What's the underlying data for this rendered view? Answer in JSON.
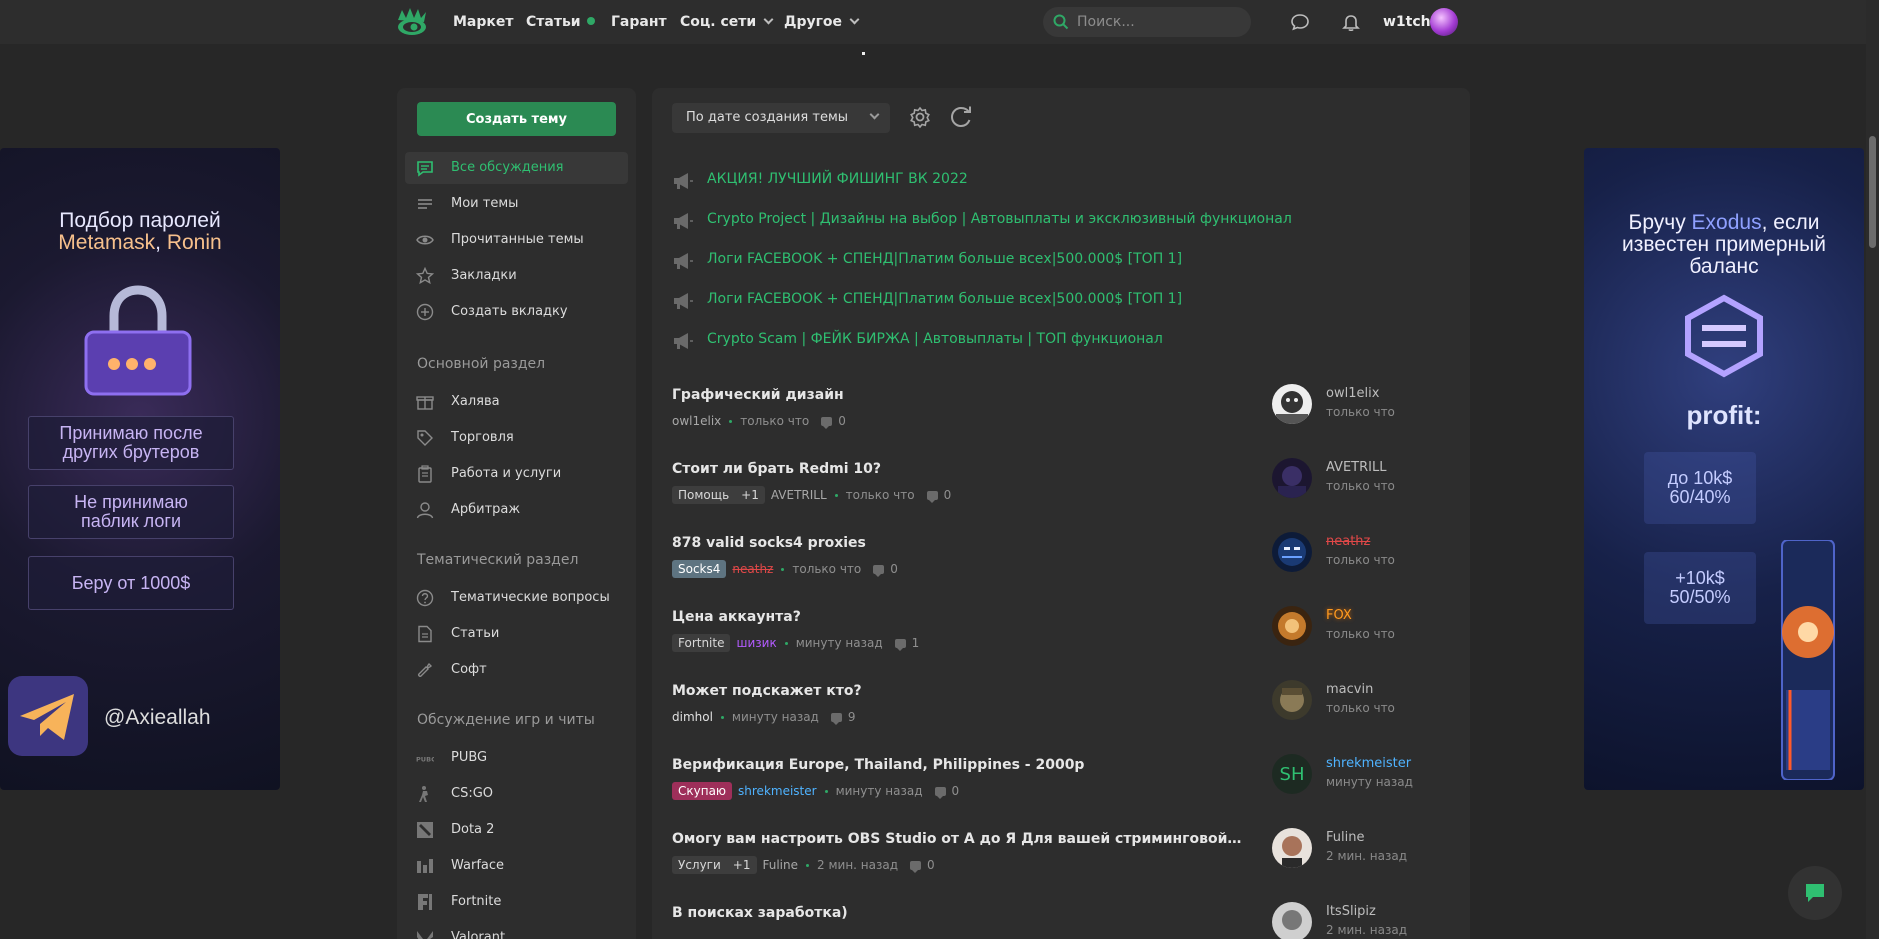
{
  "topbar": {
    "logo_icon": "eye-logo-icon",
    "nav": [
      {
        "label": "Маркет"
      },
      {
        "label": "Статьи",
        "has_dot": true
      },
      {
        "label": "Гарант"
      },
      {
        "label": "Соц. сети",
        "has_chevron": true
      },
      {
        "label": "Другое",
        "has_chevron": true
      }
    ],
    "search_placeholder": "Поиск...",
    "username": "w1tch"
  },
  "banner_left": {
    "title_line1": "Подбор паролей",
    "title_line2a": "Metamask",
    "title_line2b": ", ",
    "title_line2c": "Ronin",
    "box1_line1": "Принимаю после",
    "box1_line2": "других брутеров",
    "box2_line1": "Не принимаю",
    "box2_line2": "паблик логи",
    "box3": "Беру от 1000$",
    "handle": "@Axieallah"
  },
  "banner_right": {
    "title_line1a": "Бручу ",
    "title_line1b": "Exodus",
    "title_line1c": ", если",
    "title_line2": "известен примерный",
    "title_line3": "баланс",
    "profit": "profit:",
    "box1_line1": "до 10k$",
    "box1_line2": "60/40%",
    "box2_line1": "+10k$",
    "box2_line2": "50/50%"
  },
  "sidebar": {
    "create_button": "Создать тему",
    "items": [
      {
        "label": "Все обсуждения",
        "icon": "chat-bubble-icon",
        "active": true
      },
      {
        "label": "Мои темы",
        "icon": "lines-icon"
      },
      {
        "label": "Прочитанные темы",
        "icon": "eye-icon"
      },
      {
        "label": "Закладки",
        "icon": "star-icon"
      },
      {
        "label": "Создать вкладку",
        "icon": "plus-circle-icon"
      }
    ],
    "sections": [
      {
        "title": "Основной раздел",
        "items": [
          {
            "label": "Халява",
            "icon": "gift-icon"
          },
          {
            "label": "Торговля",
            "icon": "tag-icon"
          },
          {
            "label": "Работа и услуги",
            "icon": "clipboard-icon"
          },
          {
            "label": "Арбитраж",
            "icon": "user-icon"
          }
        ]
      },
      {
        "title": "Тематический раздел",
        "items": [
          {
            "label": "Тематические вопросы",
            "icon": "question-icon"
          },
          {
            "label": "Статьи",
            "icon": "document-icon"
          },
          {
            "label": "Софт",
            "icon": "wrench-icon"
          }
        ]
      },
      {
        "title": "Обсуждение игр и читы",
        "items": [
          {
            "label": "PUBG",
            "icon": "pubg-icon"
          },
          {
            "label": "CS:GO",
            "icon": "csgo-icon"
          },
          {
            "label": "Dota 2",
            "icon": "dota-icon"
          },
          {
            "label": "Warface",
            "icon": "warface-icon"
          },
          {
            "label": "Fortnite",
            "icon": "fortnite-icon"
          },
          {
            "label": "Valorant",
            "icon": "valorant-icon"
          }
        ]
      }
    ]
  },
  "main": {
    "sort_label": "По дате создания темы",
    "sticky": [
      "АКЦИЯ! ЛУЧШИЙ ФИШИНГ ВК 2022",
      "Crypto Project | Дизайны на выбор | Автовыплаты и эксклюзивный функционал",
      "Логи FACEBOOK + СПЕНД|Платим больше всех|500.000$ [ТОП 1]",
      "Логи FACEBOOK + СПЕНД|Платим больше всех|500.000$ [ТОП 1]",
      "Crypto Scam | ФЕЙК БИРЖА | Автовыплаты | ТОП функционал"
    ],
    "threads": [
      {
        "title": "Графический дизайн",
        "prefix": "",
        "plus": "",
        "author": "owl1elix",
        "time": "только что",
        "comments": "0",
        "last_user": "owl1elix",
        "last_time": "только что"
      },
      {
        "title": "Стоит ли брать Redmi 10?",
        "prefix": "Помощь",
        "plus": "+1",
        "author": "AVETRILL",
        "time": "только что",
        "comments": "0",
        "last_user": "AVETRILL",
        "last_time": "только что"
      },
      {
        "title": "878 valid socks4 proxies",
        "prefix": "Socks4",
        "plus": "",
        "author": "neathz",
        "time": "только что",
        "comments": "0",
        "last_user": "neathz",
        "last_time": "только что"
      },
      {
        "title": "Цена аккаунта?",
        "prefix": "Fortnite",
        "plus": "",
        "author": "шизик",
        "time": "минуту назад",
        "comments": "1",
        "last_user": "FOX",
        "last_time": "только что"
      },
      {
        "title": "Может подскажет кто?",
        "prefix": "",
        "plus": "",
        "author": "dimhol",
        "time": "минуту назад",
        "comments": "9",
        "last_user": "macvin",
        "last_time": "только что"
      },
      {
        "title": "Верификация Europe, Thailand, Philippines - 2000р",
        "prefix": "Скупаю",
        "plus": "",
        "author": "shrekmeister",
        "time": "минуту назад",
        "comments": "0",
        "last_user": "shrekmeister",
        "last_time": "минуту назад",
        "last_initials": "SH"
      },
      {
        "title": "Омогу вам настроить OBS Studio от А до Я Для вашей стриминговой деятельности",
        "prefix": "Услуги",
        "plus": "+1",
        "author": "Fuline",
        "time": "2 мин. назад",
        "comments": "0",
        "last_user": "Fuline",
        "last_time": "2 мин. назад"
      },
      {
        "title": "В поисках заработка)",
        "prefix": "",
        "plus": "",
        "author": "",
        "time": "",
        "comments": "",
        "last_user": "ItsSlipiz",
        "last_time": "2 мин. назад"
      }
    ]
  },
  "colors": {
    "accent": "#2fbf71",
    "button": "#2b8a53",
    "panel": "#2d2d2d",
    "background": "#272727"
  }
}
